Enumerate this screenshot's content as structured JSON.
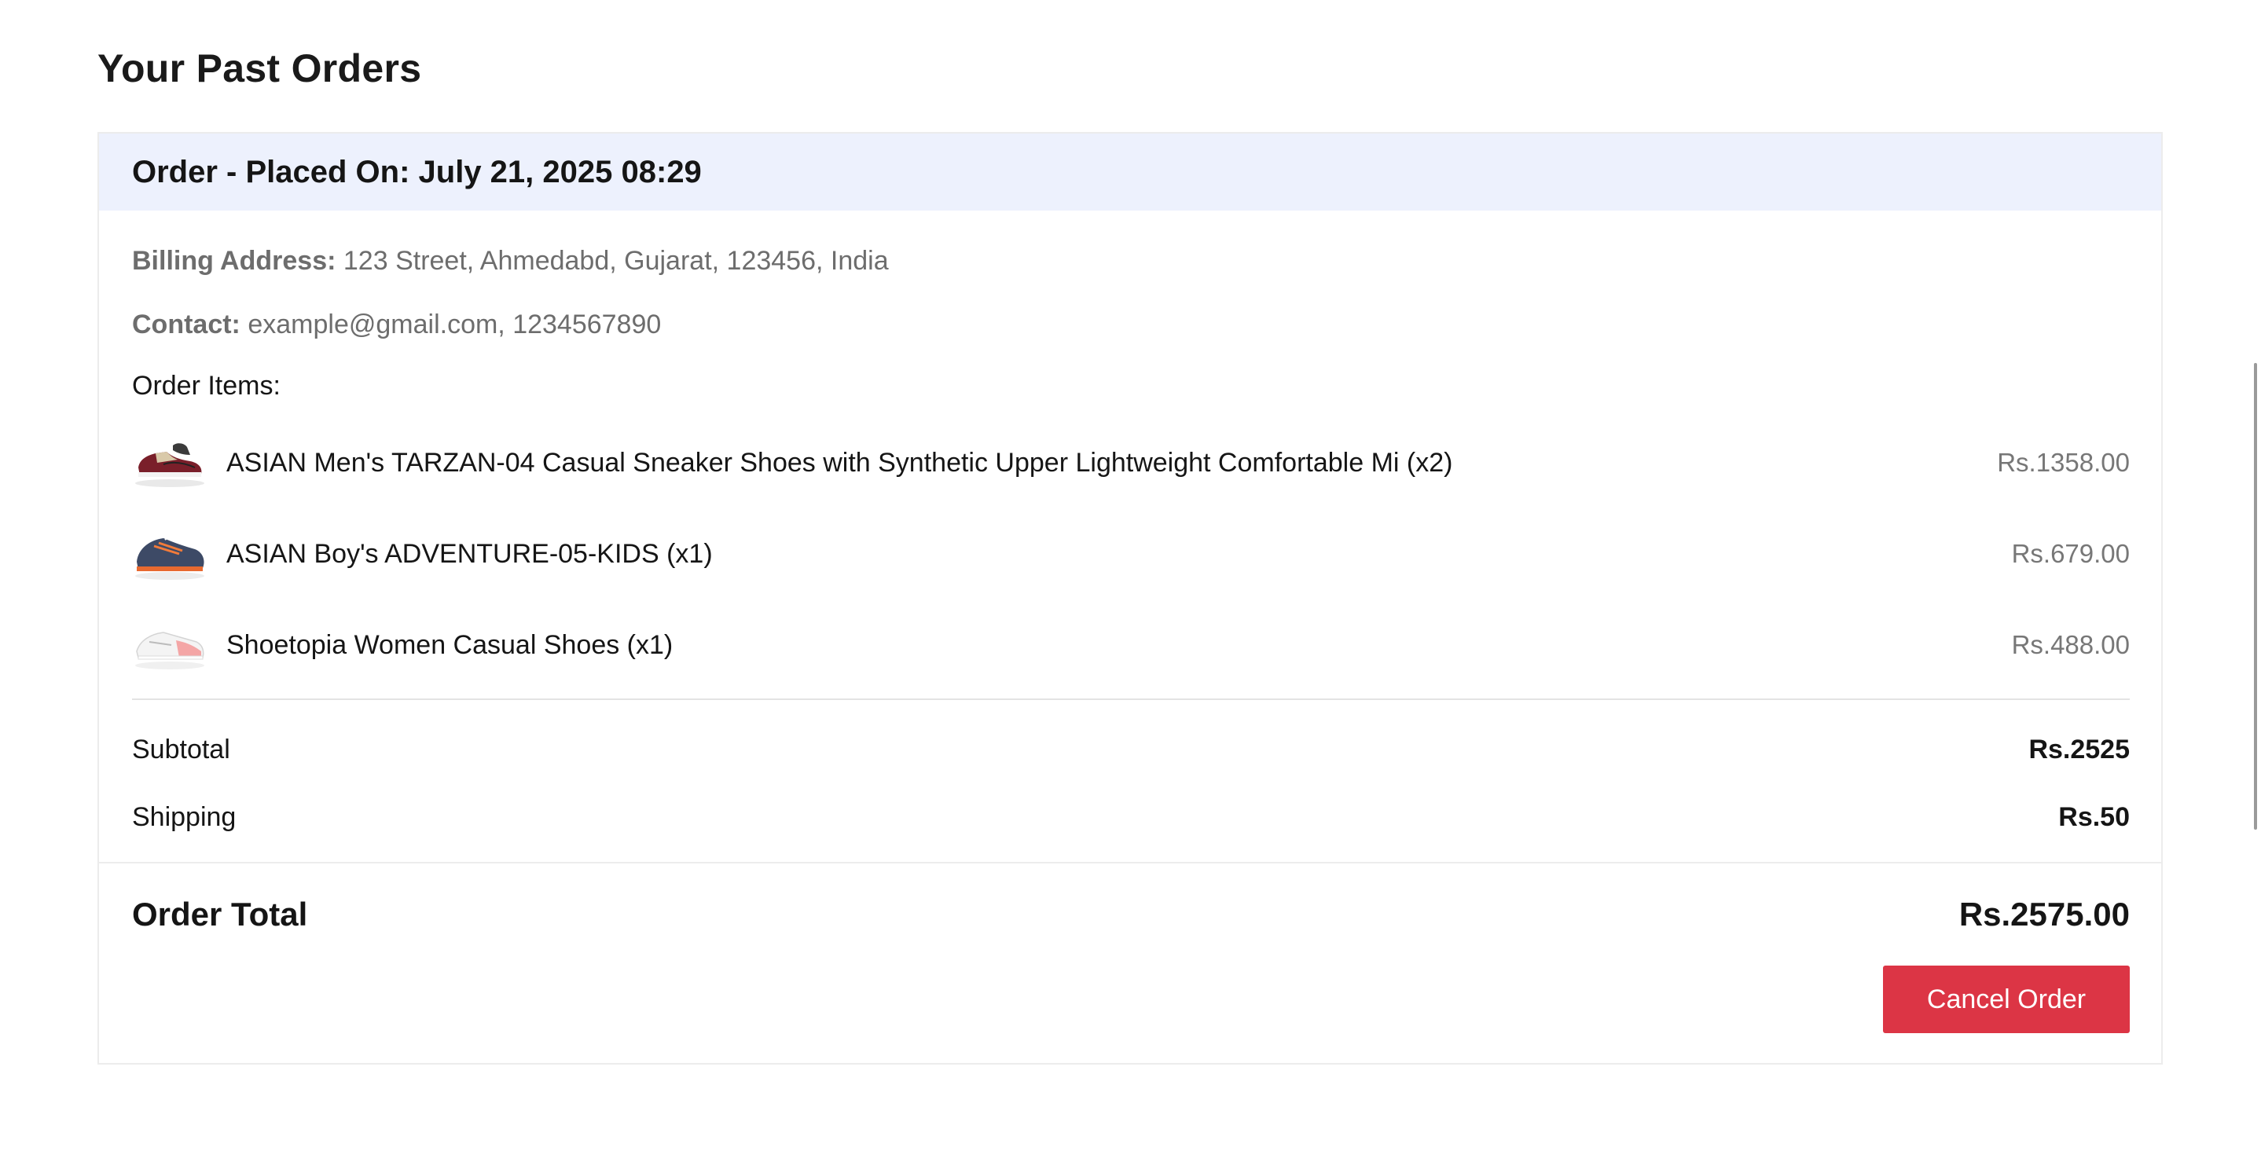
{
  "page": {
    "title": "Your Past Orders"
  },
  "order": {
    "header": "Order - Placed On: July 21, 2025 08:29",
    "billing_label": "Billing Address:",
    "billing_value": "123 Street, Ahmedabd, Gujarat, 123456, India",
    "contact_label": "Contact:",
    "contact_value": "example@gmail.com, 1234567890",
    "items_heading": "Order Items:",
    "items": [
      {
        "name": "ASIAN Men's TARZAN-04 Casual Sneaker Shoes with Synthetic Upper Lightweight Comfortable Mi (x2)",
        "price": "Rs.1358.00",
        "icon": "sneaker-thumbnail-maroon-beige"
      },
      {
        "name": "ASIAN Boy's ADVENTURE-05-KIDS (x1)",
        "price": "Rs.679.00",
        "icon": "sneaker-thumbnail-navy-orange"
      },
      {
        "name": "Shoetopia Women Casual Shoes (x1)",
        "price": "Rs.488.00",
        "icon": "sneaker-thumbnail-white-pink"
      }
    ],
    "subtotal_label": "Subtotal",
    "subtotal_value": "Rs.2525",
    "shipping_label": "Shipping",
    "shipping_value": "Rs.50",
    "total_label": "Order Total",
    "total_value": "Rs.2575.00",
    "cancel_label": "Cancel Order"
  },
  "colors": {
    "header_bg": "#edf1fd",
    "cancel_button": "#dc3545",
    "muted_text": "#6d6d6d"
  }
}
